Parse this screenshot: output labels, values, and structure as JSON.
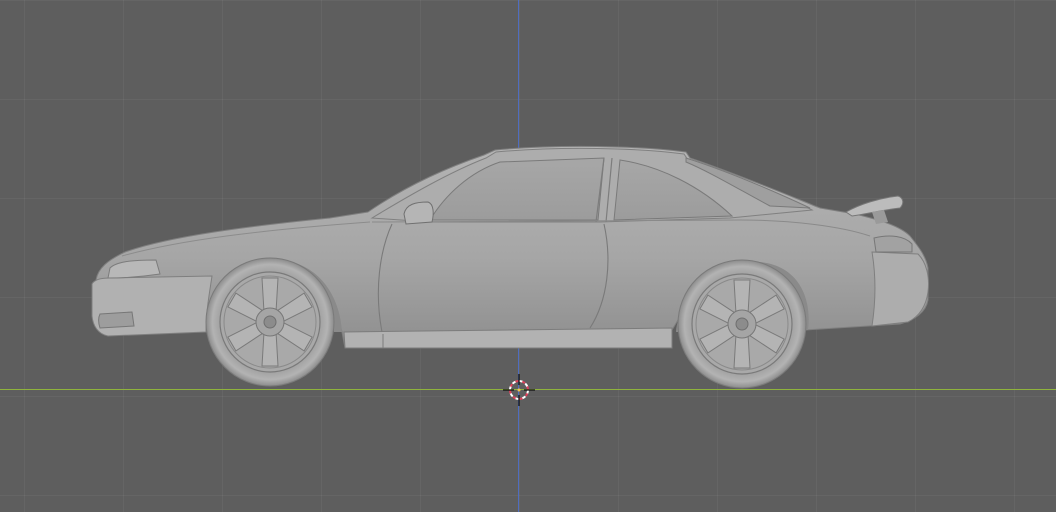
{
  "viewport": {
    "background": "#5e5e5e",
    "x_axis_color": "#8fb33d",
    "z_axis_color": "#4f6dc0"
  },
  "scene": {
    "object": "car-model",
    "shading": "solid-gray",
    "body_color": "#a8a8a8",
    "cursor_icon": "3d-cursor-icon"
  }
}
